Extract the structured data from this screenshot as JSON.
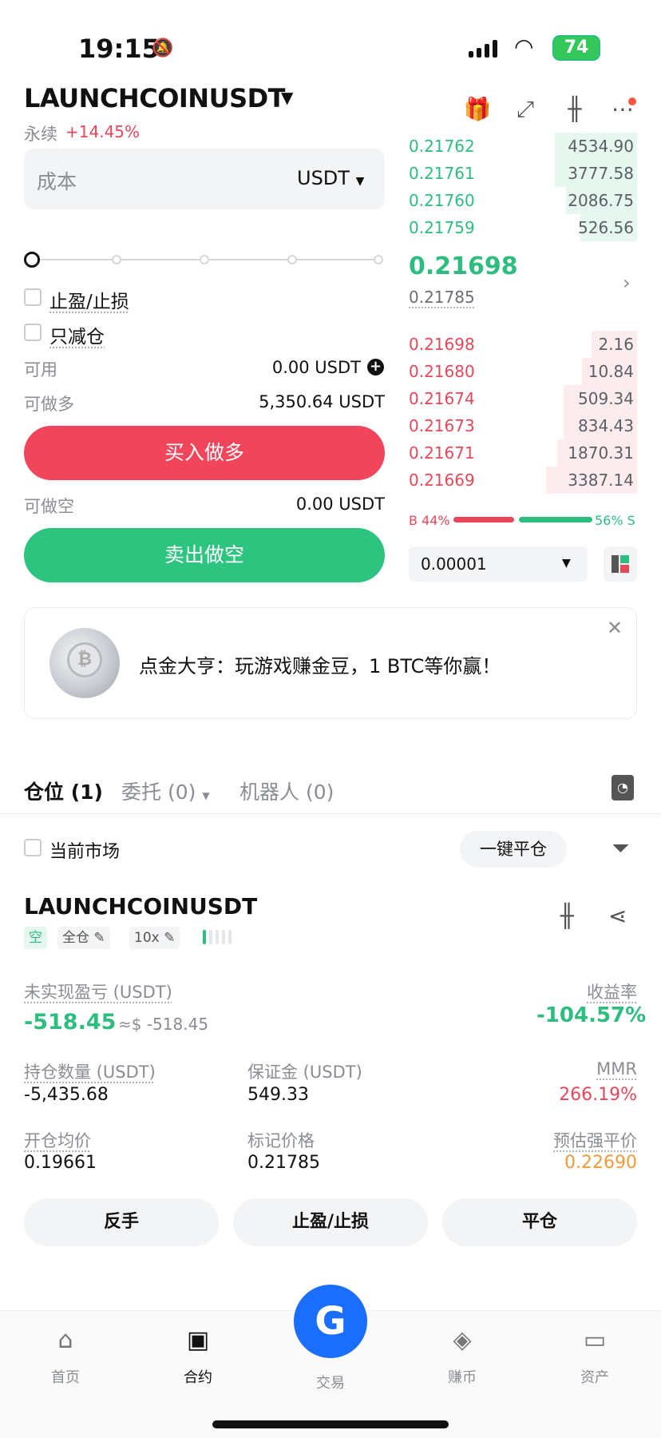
{
  "status_bar": {
    "time": "19:15",
    "battery": "74"
  },
  "header": {
    "pair": "LAUNCHCOINUSDT",
    "contract_type": "永续",
    "change": "+14.45%",
    "icons": [
      "gift-icon",
      "chart-swap-icon",
      "candlestick-icon",
      "more-icon"
    ]
  },
  "order_form": {
    "cost_placeholder": "成本",
    "unit": "USDT",
    "take_profit_stop_loss": "止盈/止损",
    "reduce_only": "只减仓",
    "available_label": "可用",
    "available_value": "0.00 USDT",
    "max_long_label": "可做多",
    "max_long_value": "5,350.64 USDT",
    "buy_button": "买入做多",
    "max_short_label": "可做空",
    "max_short_value": "0.00 USDT",
    "sell_button": "卖出做空",
    "slider_percent": 0
  },
  "order_book": {
    "asks_top": [
      {
        "price": "0.21762",
        "qty": "4534.90",
        "depth": 0.36
      },
      {
        "price": "0.21761",
        "qty": "3777.58",
        "depth": 0.36
      },
      {
        "price": "0.21760",
        "qty": "2086.75",
        "depth": 0.31
      },
      {
        "price": "0.21759",
        "qty": "526.56",
        "depth": 0.25
      }
    ],
    "last_price": "0.21698",
    "mark_price": "0.21785",
    "bids": [
      {
        "price": "0.21698",
        "qty": "2.16",
        "depth": 0.2
      },
      {
        "price": "0.21680",
        "qty": "10.84",
        "depth": 0.24
      },
      {
        "price": "0.21674",
        "qty": "509.34",
        "depth": 0.32
      },
      {
        "price": "0.21673",
        "qty": "834.43",
        "depth": 0.32
      },
      {
        "price": "0.21671",
        "qty": "1870.31",
        "depth": 0.35
      },
      {
        "price": "0.21669",
        "qty": "3387.14",
        "depth": 0.4
      }
    ],
    "buy_ratio": "B 44%",
    "sell_ratio": "56% S",
    "precision": "0.00001"
  },
  "banner": {
    "text": "点金大亨：玩游戏赚金豆，1 BTC等你赢！",
    "coin_glyph": "₿"
  },
  "positions": {
    "tabs": [
      "仓位 (1)",
      "委托 (0)",
      "机器人 (0)"
    ],
    "current_market": "当前市场",
    "close_all": "一键平仓"
  },
  "position": {
    "symbol": "LAUNCHCOINUSDT",
    "side": "空",
    "margin_mode": "全仓",
    "leverage": "10x",
    "unrealized_pnl_label": "未实现盈亏 (USDT)",
    "unrealized_pnl": "-518.45",
    "unrealized_pnl_approx": "≈$ -518.45",
    "roe_label": "收益率",
    "roe": "-104.57%",
    "size_label": "持仓数量 (USDT)",
    "size": "-5,435.68",
    "margin_label": "保证金 (USDT)",
    "margin": "549.33",
    "mmr_label": "MMR",
    "mmr": "266.19%",
    "entry_label": "开仓均价",
    "entry": "0.19661",
    "mark_label": "标记价格",
    "mark": "0.21785",
    "liq_label": "预估强平价",
    "liq": "0.22690",
    "buttons": [
      "反手",
      "止盈/止损",
      "平仓"
    ]
  },
  "nav": {
    "items": [
      {
        "label": "首页",
        "icon": "home-icon"
      },
      {
        "label": "合约",
        "icon": "futures-icon"
      },
      {
        "label": "交易",
        "icon": "trade-icon"
      },
      {
        "label": "赚币",
        "icon": "earn-icon"
      },
      {
        "label": "资产",
        "icon": "wallet-icon"
      }
    ]
  },
  "colors": {
    "green": "#2dbd7e",
    "red": "#e8475a",
    "blue": "#1b6dfb",
    "orange": "#f29a3a"
  }
}
